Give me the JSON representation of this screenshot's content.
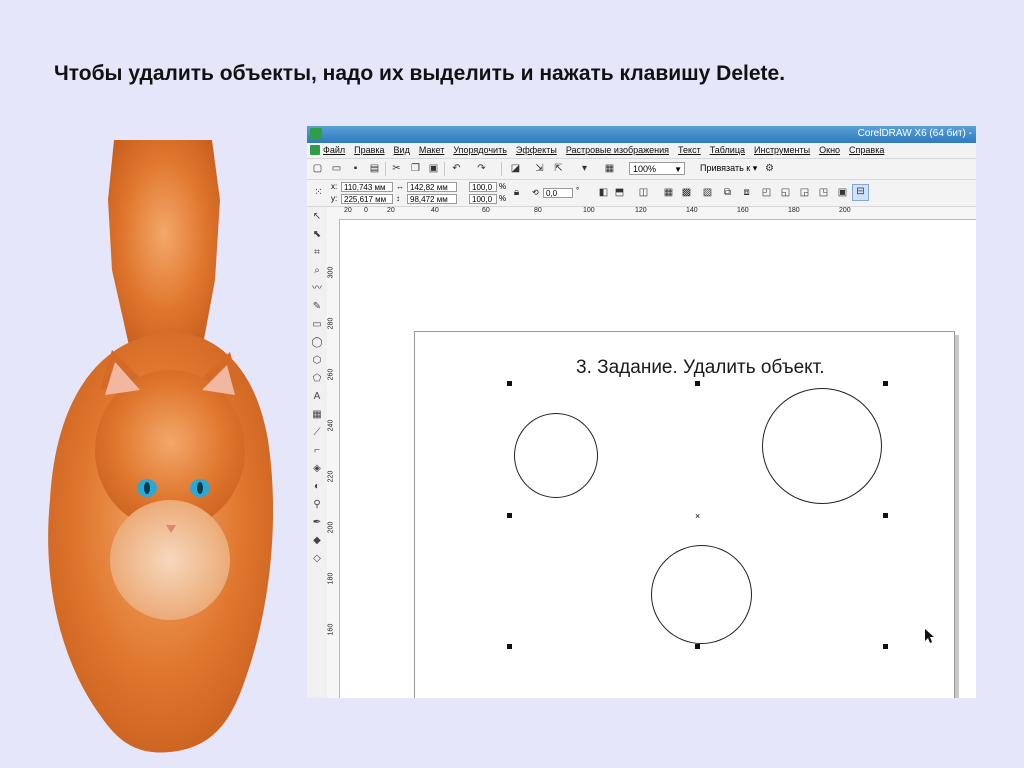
{
  "slide": {
    "title": "Чтобы удалить объекты, надо их выделить и нажать клавишу Delete."
  },
  "app": {
    "title": "CorelDRAW X6 (64 бит) -",
    "menu": [
      "Файл",
      "Правка",
      "Вид",
      "Макет",
      "Упорядочить",
      "Эффекты",
      "Растровые изображения",
      "Текст",
      "Таблица",
      "Инструменты",
      "Окно",
      "Справка"
    ],
    "zoom": "100%",
    "snap_label": "Привязать к",
    "props": {
      "x_label": "x:",
      "x": "110,743 мм",
      "y_label": "y:",
      "y": "225,617 мм",
      "w": "142,82 мм",
      "h": "98,472 мм",
      "scale_w": "100,0",
      "scale_h": "100,0",
      "pct": "%",
      "rotation": "0,0",
      "deg": "°"
    },
    "ruler_h": [
      "20",
      "0",
      "20",
      "40",
      "60",
      "80",
      "100",
      "120",
      "140",
      "160",
      "180",
      "200"
    ],
    "ruler_v": [
      "300",
      "280",
      "260",
      "240",
      "220",
      "200",
      "180",
      "160"
    ]
  },
  "document": {
    "task_text": "3. Задание. Удалить объект."
  },
  "icons": {
    "cat_image": "orange-cat-photo"
  },
  "colors": {
    "background": "#e6e6fa",
    "titlebar": "#3d8bcd",
    "app_icon": "#2e9e46"
  }
}
